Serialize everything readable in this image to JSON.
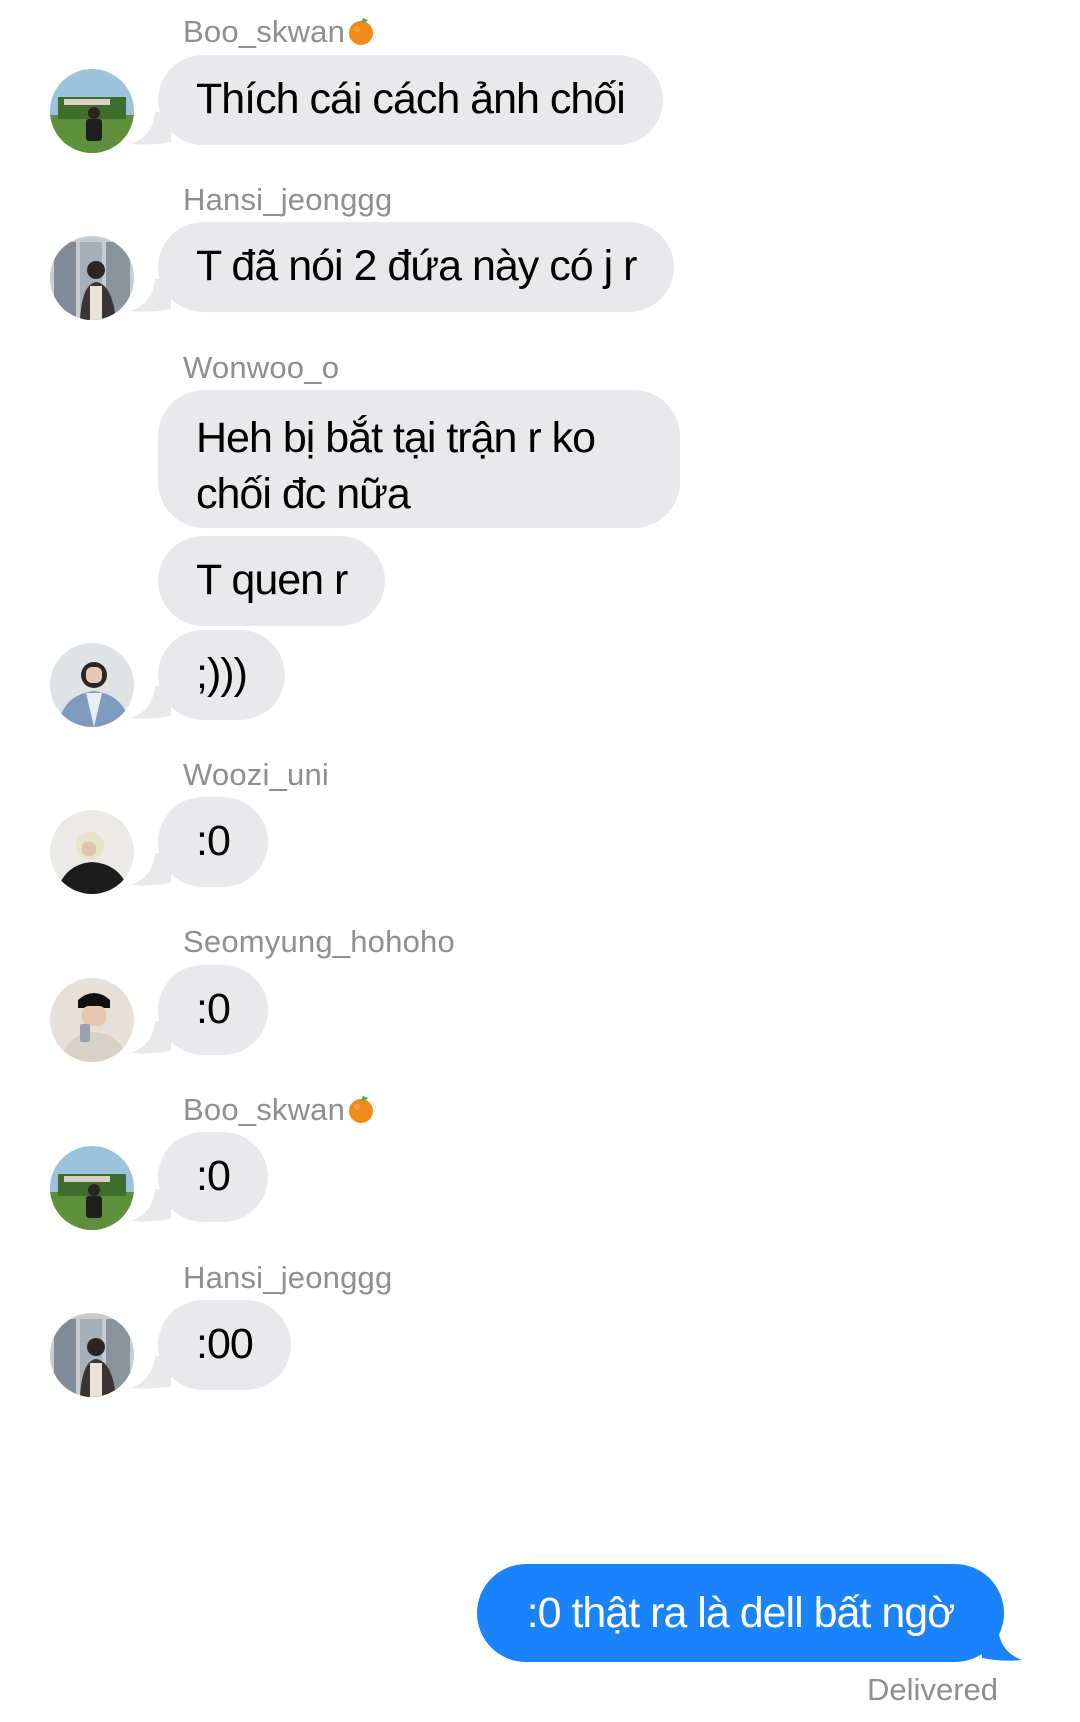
{
  "colors": {
    "incoming_bubble": "#e9e9eb",
    "outgoing_bubble": "#1a82fb",
    "sender_name": "#8e8e93"
  },
  "messages": [
    {
      "sender": "Boo_skwan",
      "sender_emoji": "tangerine-emoji",
      "text": "Thích cái cách ảnh chối"
    },
    {
      "sender": "Hansi_jeonggg",
      "text": "T đã nói 2 đứa này có j r"
    },
    {
      "sender": "Wonwoo_o",
      "texts": [
        "Heh bị bắt tại trận r ko chối đc nữa",
        "T quen r",
        ";)))"
      ]
    },
    {
      "sender": "Woozi_uni",
      "text": ":0"
    },
    {
      "sender": "Seomyung_hohoho",
      "text": ":0"
    },
    {
      "sender": "Boo_skwan",
      "sender_emoji": "tangerine-emoji",
      "text": ":0"
    },
    {
      "sender": "Hansi_jeonggg",
      "text": ":00"
    }
  ],
  "outgoing": {
    "text": ":0 thật ra là dell bất ngờ",
    "status": "Delivered"
  }
}
